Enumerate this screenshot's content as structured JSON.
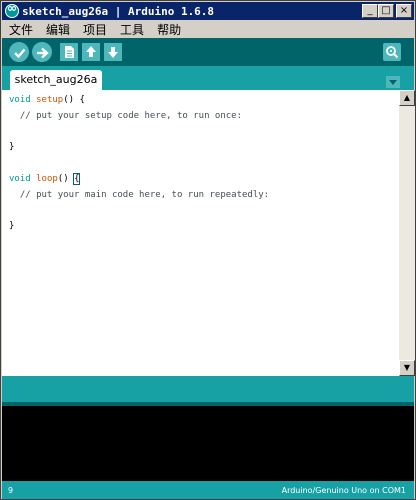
{
  "window": {
    "title": "sketch_aug26a | Arduino 1.6.8",
    "buttons": {
      "minimize": "_",
      "maximize": "□",
      "close": "×"
    }
  },
  "menu": [
    "文件",
    "编辑",
    "项目",
    "工具",
    "帮助"
  ],
  "toolbar": {
    "icons": [
      "verify-icon",
      "upload-icon",
      "new-icon",
      "open-icon",
      "save-icon",
      "serial-monitor-icon"
    ]
  },
  "tabs": [
    {
      "label": "sketch_aug26a"
    }
  ],
  "editor": {
    "lines": {
      "setup_void": "void",
      "setup_fn": "setup",
      "setup_rest": "() {",
      "setup_comment": "  // put your setup code here, to run once:",
      "close1": "}",
      "loop_void": "void",
      "loop_fn": "loop",
      "loop_paren": "() ",
      "loop_brace": "{",
      "loop_comment": "  // put your main code here, to run repeatedly:",
      "close2": "}"
    }
  },
  "statusbar": {
    "line_number": "9",
    "board": "Arduino/Genuino Uno on COM1"
  },
  "colors": {
    "teal_dark": "#006468",
    "teal": "#17a1a5",
    "button": "#4db7bb",
    "keyword": "#00979c",
    "function": "#d35400"
  }
}
